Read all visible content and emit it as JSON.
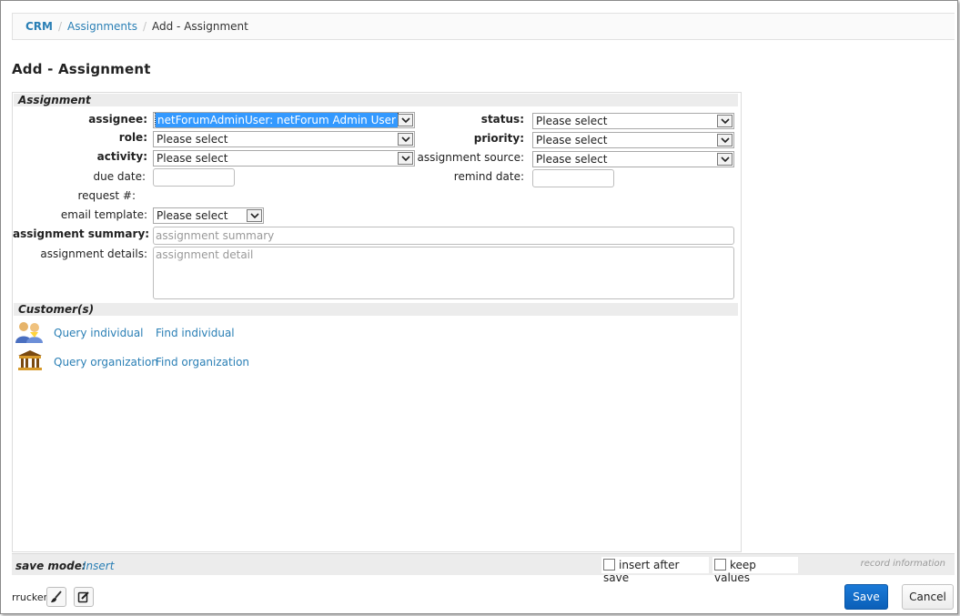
{
  "breadcrumb": {
    "root": "CRM",
    "parent": "Assignments",
    "current": "Add - Assignment"
  },
  "page_title": "Add - Assignment",
  "sections": {
    "assignment": "Assignment",
    "customers": "Customer(s)"
  },
  "form": {
    "assignee": {
      "label": "assignee:",
      "value": "netForumAdminUser: netForum Admin User"
    },
    "role": {
      "label": "role:",
      "value": "Please select"
    },
    "activity": {
      "label": "activity:",
      "value": "Please select"
    },
    "due_date": {
      "label": "due date:",
      "value": ""
    },
    "request_no": {
      "label": "request #:"
    },
    "email_template": {
      "label": "email template:",
      "value": "Please select"
    },
    "status": {
      "label": "status:",
      "value": "Please select"
    },
    "priority": {
      "label": "priority:",
      "value": "Please select"
    },
    "assignment_source": {
      "label": "assignment source:",
      "value": "Please select"
    },
    "remind_date": {
      "label": "remind date:",
      "value": ""
    },
    "assignment_summary": {
      "label": "assignment summary:",
      "placeholder": "assignment summary"
    },
    "assignment_details": {
      "label": "assignment details:",
      "placeholder": "assignment detail"
    }
  },
  "customers": {
    "individual": {
      "icon": "people-icon",
      "query": "Query individual",
      "find": "Find individual"
    },
    "organization": {
      "icon": "organization-building-icon",
      "query": "Query organization",
      "find": "Find organization"
    }
  },
  "footer": {
    "save_mode_label": "save mode:",
    "save_mode_value": "Insert",
    "insert_after_save": "insert after save",
    "keep_values": "keep values",
    "record_information": "record information"
  },
  "user": {
    "name": "rrucker",
    "icons": [
      "brush-icon",
      "edit-icon"
    ]
  },
  "buttons": {
    "save": "Save",
    "cancel": "Cancel"
  },
  "colors": {
    "link": "#2a7fb5",
    "primary_button": "#0b5fb8",
    "selection_highlight": "#3399ff",
    "section_header_bg": "#ececec"
  }
}
